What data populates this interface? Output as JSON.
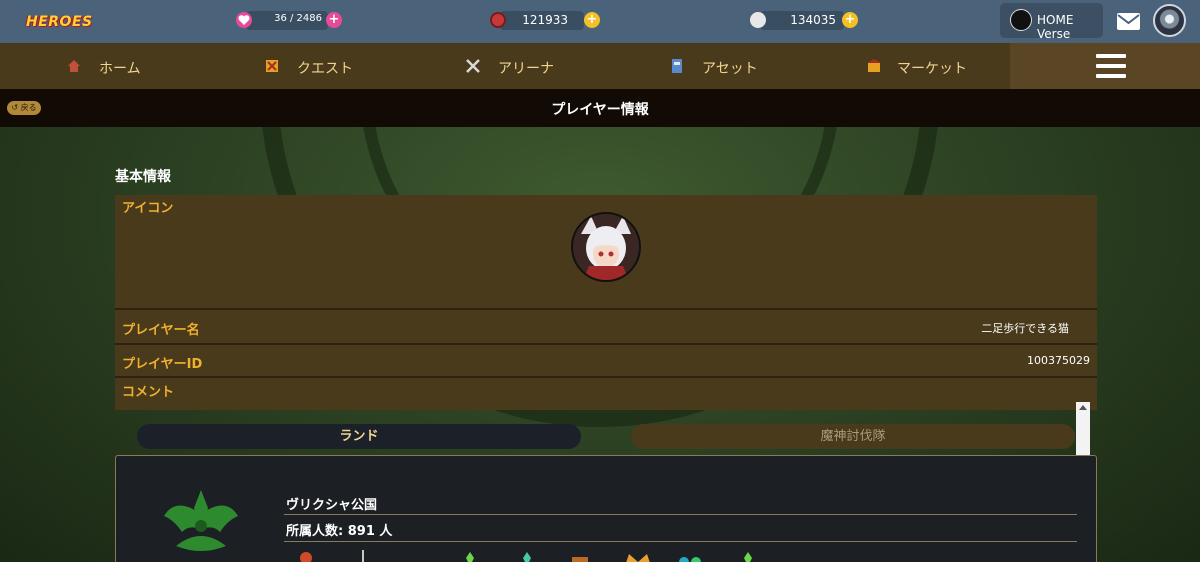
{
  "header": {
    "logo_text": "HEROES",
    "stamina": {
      "value": "36 / 2486",
      "color": "#e84a9a"
    },
    "currency1": {
      "value": "121933"
    },
    "currency2": {
      "value": "134035"
    },
    "home_verse_label": "HOME Verse"
  },
  "nav": {
    "items": [
      {
        "label": "ホーム",
        "icon": "home-icon"
      },
      {
        "label": "クエスト",
        "icon": "quest-icon"
      },
      {
        "label": "アリーナ",
        "icon": "arena-icon"
      },
      {
        "label": "アセット",
        "icon": "asset-icon"
      },
      {
        "label": "マーケット",
        "icon": "market-icon"
      }
    ]
  },
  "titlebar": {
    "back_label": "戻る",
    "title": "プレイヤー情報"
  },
  "basic_info": {
    "section_title": "基本情報",
    "icon_label": "アイコン",
    "name_label": "プレイヤー名",
    "name_value": "二足歩行できる猫",
    "id_label": "プレイヤーID",
    "id_value": "100375029",
    "comment_label": "コメント",
    "comment_value": ""
  },
  "tabs": {
    "land": "ランド",
    "demon": "魔神討伐隊"
  },
  "land": {
    "name": "ヴリクシャ公国",
    "members": "所属人数: 891 人"
  },
  "colors": {
    "accent_gold": "#f0b030",
    "panel_brown": "#4a3a1c",
    "coin_yellow": "#f5c023"
  }
}
